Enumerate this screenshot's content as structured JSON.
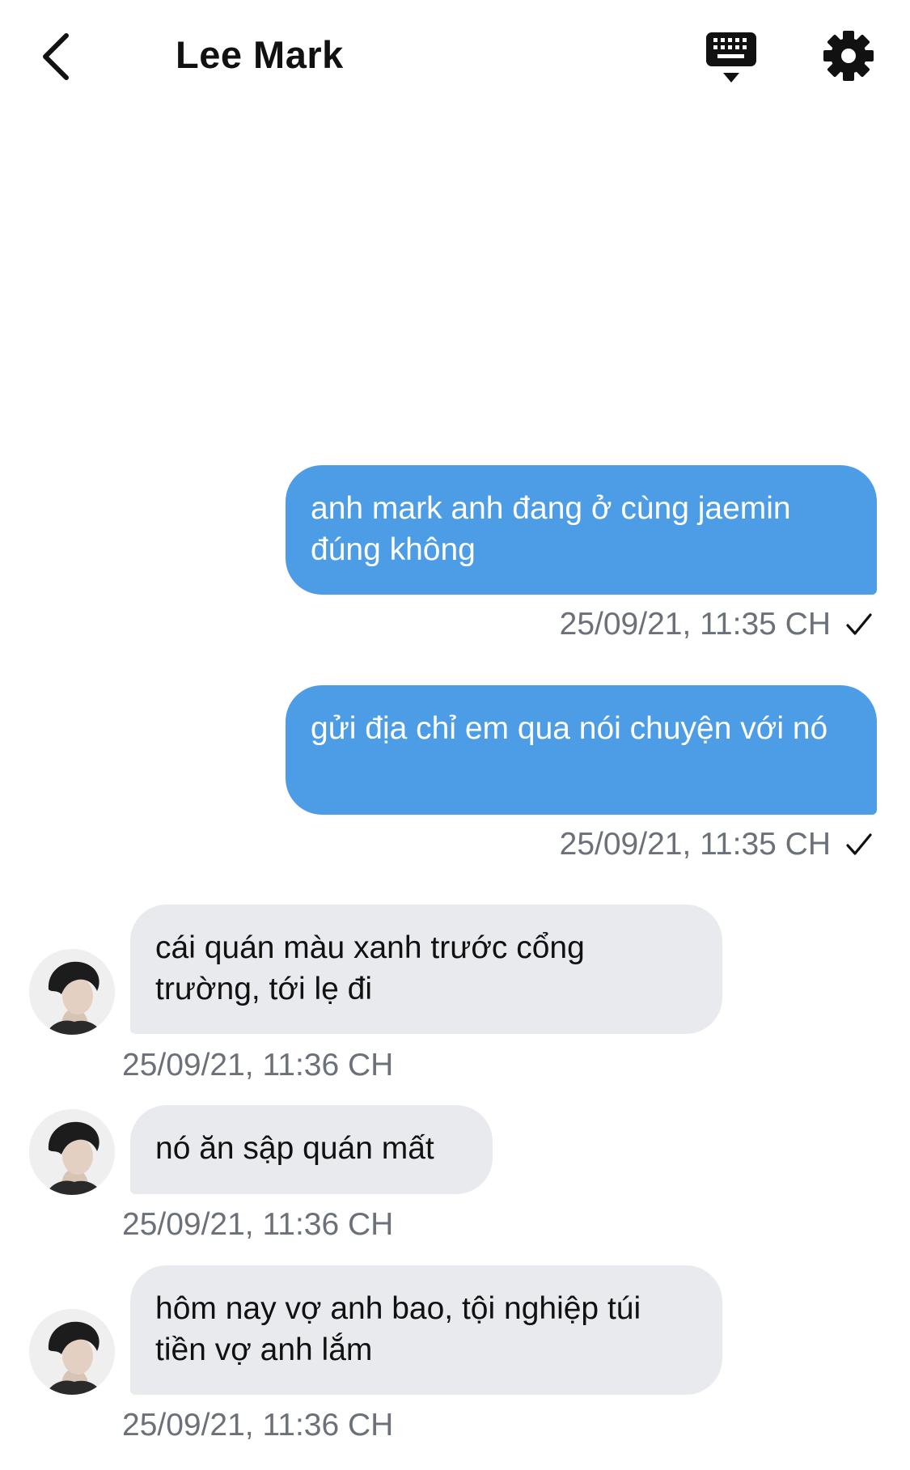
{
  "header": {
    "title": "Lee Mark"
  },
  "icons": {
    "back": "chevron-left-icon",
    "keyboard": "keyboard-icon",
    "settings": "gear-icon"
  },
  "colors": {
    "outgoing_bubble": "#4d9de6",
    "incoming_bubble": "#e9eaee",
    "timestamp": "#6b7079"
  },
  "messages": [
    {
      "direction": "outgoing",
      "text": "anh mark anh đang ở cùng jaemin đúng không",
      "time": "25/09/21, 11:35 CH",
      "status": "sent"
    },
    {
      "direction": "outgoing",
      "text": "gửi địa chỉ em qua nói chuyện với nó",
      "time": "25/09/21, 11:35 CH",
      "status": "sent"
    },
    {
      "direction": "incoming",
      "text": "cái quán màu xanh trước cổng trường, tới lẹ đi",
      "time": "25/09/21, 11:36 CH"
    },
    {
      "direction": "incoming",
      "text": "nó ăn sập quán mất",
      "time": "25/09/21, 11:36 CH"
    },
    {
      "direction": "incoming",
      "text": "hôm nay vợ anh bao, tội nghiệp túi tiền vợ anh lắm",
      "time": "25/09/21, 11:36 CH"
    }
  ]
}
